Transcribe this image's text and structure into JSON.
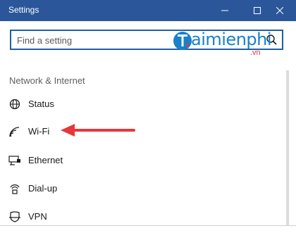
{
  "window": {
    "title": "Settings"
  },
  "search": {
    "placeholder": "Find a setting"
  },
  "watermark": {
    "brand": "aimienphi",
    "tld": ".vn"
  },
  "nav": {
    "section_header": "Network & Internet",
    "items": [
      {
        "label": "Status",
        "icon": "globe-icon"
      },
      {
        "label": "Wi-Fi",
        "icon": "wifi-icon"
      },
      {
        "label": "Ethernet",
        "icon": "ethernet-icon"
      },
      {
        "label": "Dial-up",
        "icon": "dialup-icon"
      },
      {
        "label": "VPN",
        "icon": "vpn-icon"
      }
    ]
  },
  "annotation": {
    "color": "#e8363a",
    "target": "Wi-Fi"
  },
  "colors": {
    "titlebar": "#2b579a",
    "accent": "#1e5fa8"
  }
}
